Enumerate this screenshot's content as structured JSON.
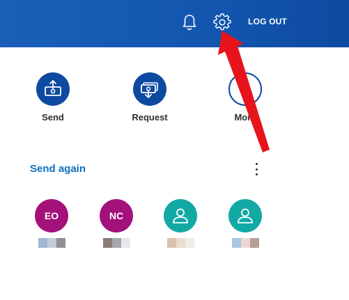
{
  "header": {
    "logout_label": "LOG OUT",
    "bell_icon": "bell-icon",
    "settings_icon": "gear-icon",
    "background_color": "#1256b0"
  },
  "actions": [
    {
      "label": "Send",
      "icon": "send-money-icon"
    },
    {
      "label": "Request",
      "icon": "request-money-icon"
    },
    {
      "label": "More",
      "icon": "more-icon"
    }
  ],
  "send_again": {
    "title": "Send again",
    "menu_icon": "kebab-menu-icon",
    "contacts": [
      {
        "initials": "EO",
        "color": "#a3117a",
        "type": "initials",
        "blurred_name_colors": [
          "#9fb6d0",
          "#c3cbd6",
          "#8f8f96"
        ]
      },
      {
        "initials": "NC",
        "color": "#a3117a",
        "type": "initials",
        "blurred_name_colors": [
          "#8a7a78",
          "#a6a8ae",
          "#e8e8ec"
        ]
      },
      {
        "initials": "",
        "color": "#12a9a5",
        "type": "user-icon",
        "blurred_name_colors": [
          "#d9c1b0",
          "#e7ddd1",
          "#f0ede6"
        ]
      },
      {
        "initials": "",
        "color": "#12a9a5",
        "type": "user-icon",
        "blurred_name_colors": [
          "#a9c6e0",
          "#ecd8d0",
          "#b6a095"
        ]
      }
    ]
  },
  "annotation": {
    "color": "#e8141c",
    "icon": "red-arrow-pointer"
  }
}
